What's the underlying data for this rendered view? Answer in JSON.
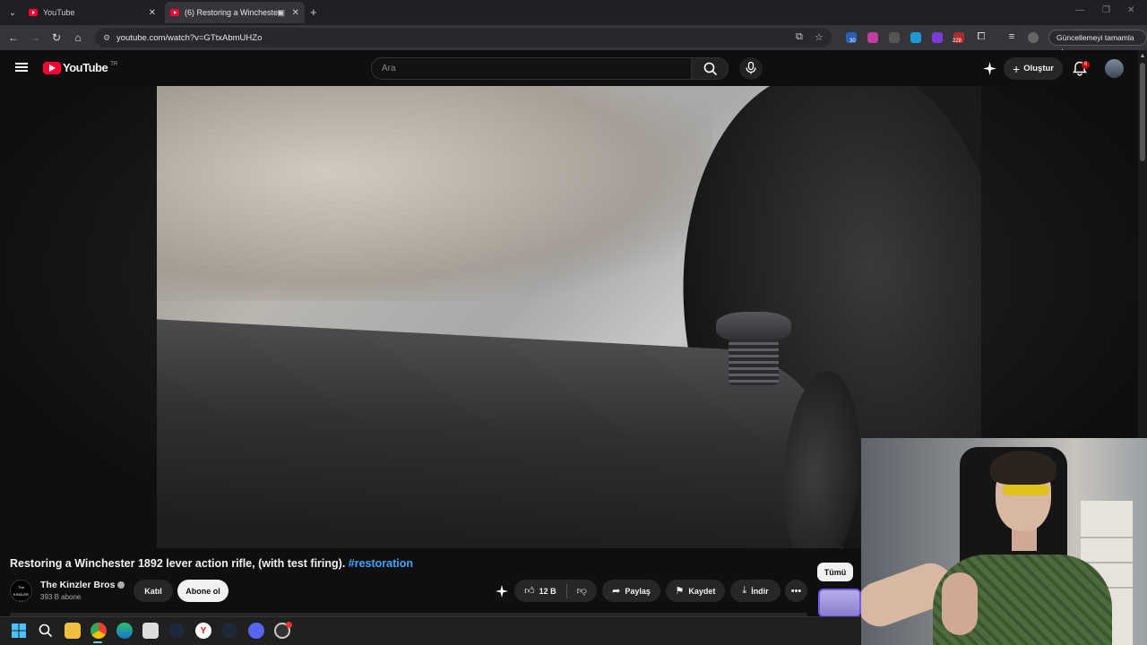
{
  "browser": {
    "tabs": [
      {
        "title": "YouTube"
      },
      {
        "title": "(6) Restoring a Winchester"
      }
    ],
    "url": "youtube.com/watch?v=GTtxAbmUHZo",
    "update_label": "Güncellemeyi tamamla",
    "ext_badges": [
      "30",
      "228"
    ]
  },
  "youtube": {
    "logo_text": "YouTube",
    "country": "TR",
    "search_placeholder": "Ara",
    "create_label": "Oluştur",
    "notif_count": "6"
  },
  "video": {
    "title": "Restoring a Winchester 1892 lever action rifle, (with test firing).",
    "hashtag": "#restoration",
    "channel": "The Kinzler Bros",
    "channel_logo": "The KINZLER BROS",
    "subscribers": "393 B abone",
    "join_label": "Katıl",
    "subscribe_label": "Abone ol",
    "likes": "12 B",
    "share_label": "Paylaş",
    "save_label": "Kaydet",
    "download_label": "İndir",
    "all_chip": "Tümü"
  },
  "colors": {
    "accent_red": "#ff0033",
    "hashtag_blue": "#3ea6ff",
    "bg": "#0f0f0f"
  },
  "taskbar_icons": [
    "windows-icon",
    "search-icon",
    "file-explorer-icon",
    "chrome-icon",
    "edge-icon",
    "store-icon",
    "steam-icon",
    "yandex-icon",
    "steam-icon-2",
    "discord-icon",
    "obs-icon"
  ]
}
